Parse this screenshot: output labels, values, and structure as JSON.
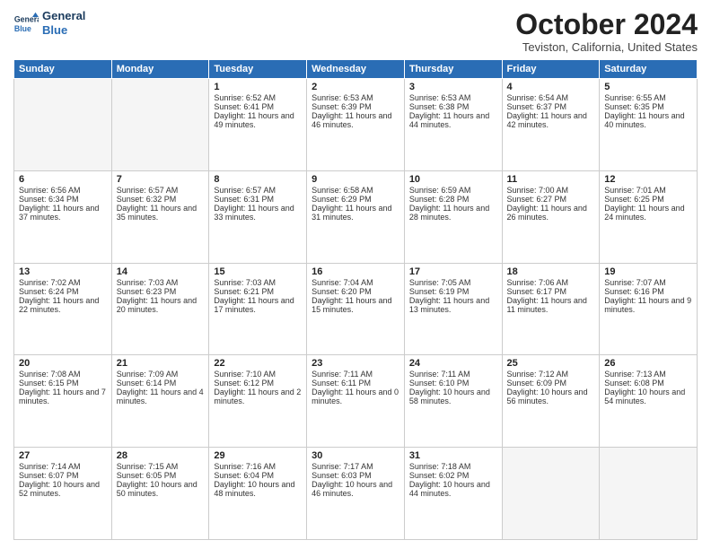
{
  "logo": {
    "line1": "General",
    "line2": "Blue"
  },
  "title": "October 2024",
  "subtitle": "Teviston, California, United States",
  "days_of_week": [
    "Sunday",
    "Monday",
    "Tuesday",
    "Wednesday",
    "Thursday",
    "Friday",
    "Saturday"
  ],
  "weeks": [
    [
      {
        "day": "",
        "empty": true
      },
      {
        "day": "",
        "empty": true
      },
      {
        "day": "1",
        "sunrise": "6:52 AM",
        "sunset": "6:41 PM",
        "daylight": "11 hours and 49 minutes."
      },
      {
        "day": "2",
        "sunrise": "6:53 AM",
        "sunset": "6:39 PM",
        "daylight": "11 hours and 46 minutes."
      },
      {
        "day": "3",
        "sunrise": "6:53 AM",
        "sunset": "6:38 PM",
        "daylight": "11 hours and 44 minutes."
      },
      {
        "day": "4",
        "sunrise": "6:54 AM",
        "sunset": "6:37 PM",
        "daylight": "11 hours and 42 minutes."
      },
      {
        "day": "5",
        "sunrise": "6:55 AM",
        "sunset": "6:35 PM",
        "daylight": "11 hours and 40 minutes."
      }
    ],
    [
      {
        "day": "6",
        "sunrise": "6:56 AM",
        "sunset": "6:34 PM",
        "daylight": "11 hours and 37 minutes."
      },
      {
        "day": "7",
        "sunrise": "6:57 AM",
        "sunset": "6:32 PM",
        "daylight": "11 hours and 35 minutes."
      },
      {
        "day": "8",
        "sunrise": "6:57 AM",
        "sunset": "6:31 PM",
        "daylight": "11 hours and 33 minutes."
      },
      {
        "day": "9",
        "sunrise": "6:58 AM",
        "sunset": "6:29 PM",
        "daylight": "11 hours and 31 minutes."
      },
      {
        "day": "10",
        "sunrise": "6:59 AM",
        "sunset": "6:28 PM",
        "daylight": "11 hours and 28 minutes."
      },
      {
        "day": "11",
        "sunrise": "7:00 AM",
        "sunset": "6:27 PM",
        "daylight": "11 hours and 26 minutes."
      },
      {
        "day": "12",
        "sunrise": "7:01 AM",
        "sunset": "6:25 PM",
        "daylight": "11 hours and 24 minutes."
      }
    ],
    [
      {
        "day": "13",
        "sunrise": "7:02 AM",
        "sunset": "6:24 PM",
        "daylight": "11 hours and 22 minutes."
      },
      {
        "day": "14",
        "sunrise": "7:03 AM",
        "sunset": "6:23 PM",
        "daylight": "11 hours and 20 minutes."
      },
      {
        "day": "15",
        "sunrise": "7:03 AM",
        "sunset": "6:21 PM",
        "daylight": "11 hours and 17 minutes."
      },
      {
        "day": "16",
        "sunrise": "7:04 AM",
        "sunset": "6:20 PM",
        "daylight": "11 hours and 15 minutes."
      },
      {
        "day": "17",
        "sunrise": "7:05 AM",
        "sunset": "6:19 PM",
        "daylight": "11 hours and 13 minutes."
      },
      {
        "day": "18",
        "sunrise": "7:06 AM",
        "sunset": "6:17 PM",
        "daylight": "11 hours and 11 minutes."
      },
      {
        "day": "19",
        "sunrise": "7:07 AM",
        "sunset": "6:16 PM",
        "daylight": "11 hours and 9 minutes."
      }
    ],
    [
      {
        "day": "20",
        "sunrise": "7:08 AM",
        "sunset": "6:15 PM",
        "daylight": "11 hours and 7 minutes."
      },
      {
        "day": "21",
        "sunrise": "7:09 AM",
        "sunset": "6:14 PM",
        "daylight": "11 hours and 4 minutes."
      },
      {
        "day": "22",
        "sunrise": "7:10 AM",
        "sunset": "6:12 PM",
        "daylight": "11 hours and 2 minutes."
      },
      {
        "day": "23",
        "sunrise": "7:11 AM",
        "sunset": "6:11 PM",
        "daylight": "11 hours and 0 minutes."
      },
      {
        "day": "24",
        "sunrise": "7:11 AM",
        "sunset": "6:10 PM",
        "daylight": "10 hours and 58 minutes."
      },
      {
        "day": "25",
        "sunrise": "7:12 AM",
        "sunset": "6:09 PM",
        "daylight": "10 hours and 56 minutes."
      },
      {
        "day": "26",
        "sunrise": "7:13 AM",
        "sunset": "6:08 PM",
        "daylight": "10 hours and 54 minutes."
      }
    ],
    [
      {
        "day": "27",
        "sunrise": "7:14 AM",
        "sunset": "6:07 PM",
        "daylight": "10 hours and 52 minutes."
      },
      {
        "day": "28",
        "sunrise": "7:15 AM",
        "sunset": "6:05 PM",
        "daylight": "10 hours and 50 minutes."
      },
      {
        "day": "29",
        "sunrise": "7:16 AM",
        "sunset": "6:04 PM",
        "daylight": "10 hours and 48 minutes."
      },
      {
        "day": "30",
        "sunrise": "7:17 AM",
        "sunset": "6:03 PM",
        "daylight": "10 hours and 46 minutes."
      },
      {
        "day": "31",
        "sunrise": "7:18 AM",
        "sunset": "6:02 PM",
        "daylight": "10 hours and 44 minutes."
      },
      {
        "day": "",
        "empty": true
      },
      {
        "day": "",
        "empty": true
      }
    ]
  ],
  "labels": {
    "sunrise_prefix": "Sunrise: ",
    "sunset_prefix": "Sunset: ",
    "daylight_prefix": "Daylight: "
  }
}
